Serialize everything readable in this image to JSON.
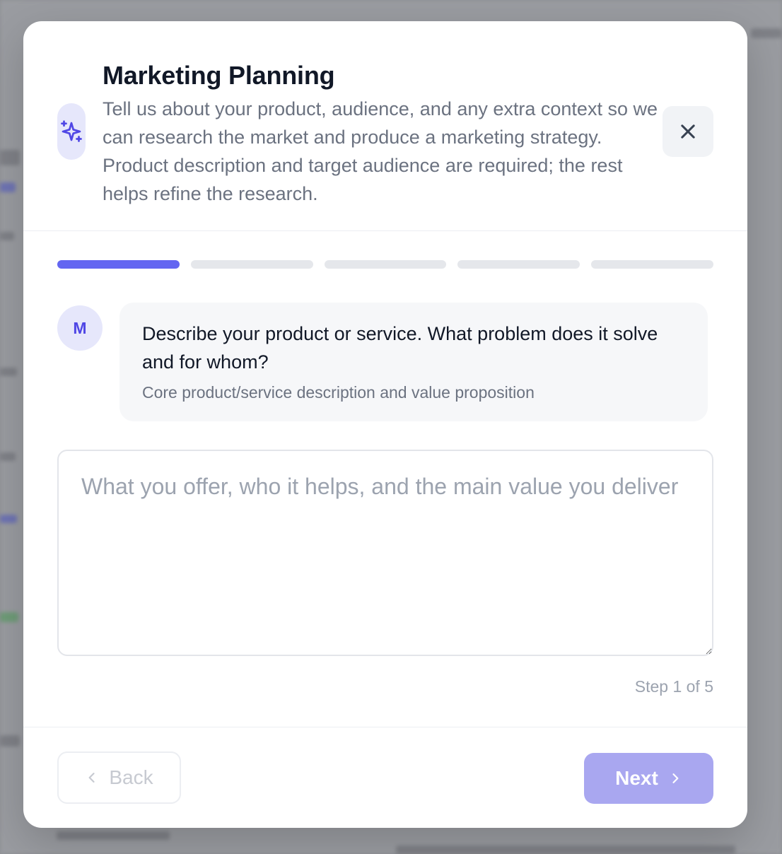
{
  "modal": {
    "title": "Marketing Planning",
    "subtitle": "Tell us about your product, audience, and any extra context so we can research the market and produce a marketing strategy. Product description and target audience are required; the rest helps refine the research.",
    "header_icon": "sparkles-icon",
    "close_icon": "close-icon"
  },
  "progress": {
    "total_steps": 5,
    "current_step": 1
  },
  "question": {
    "avatar_letter": "M",
    "text": "Describe your product or service. What problem does it solve and for whom?",
    "hint": "Core product/service description and value proposition"
  },
  "answer": {
    "value": "",
    "placeholder": "What you offer, who it helps, and the main value you deliver"
  },
  "step_indicator": "Step 1 of 5",
  "footer": {
    "back_label": "Back",
    "next_label": "Next"
  },
  "colors": {
    "accent": "#6366f1",
    "next_disabled": "#a9a7f0",
    "badge_bg": "#e6e7fb"
  }
}
